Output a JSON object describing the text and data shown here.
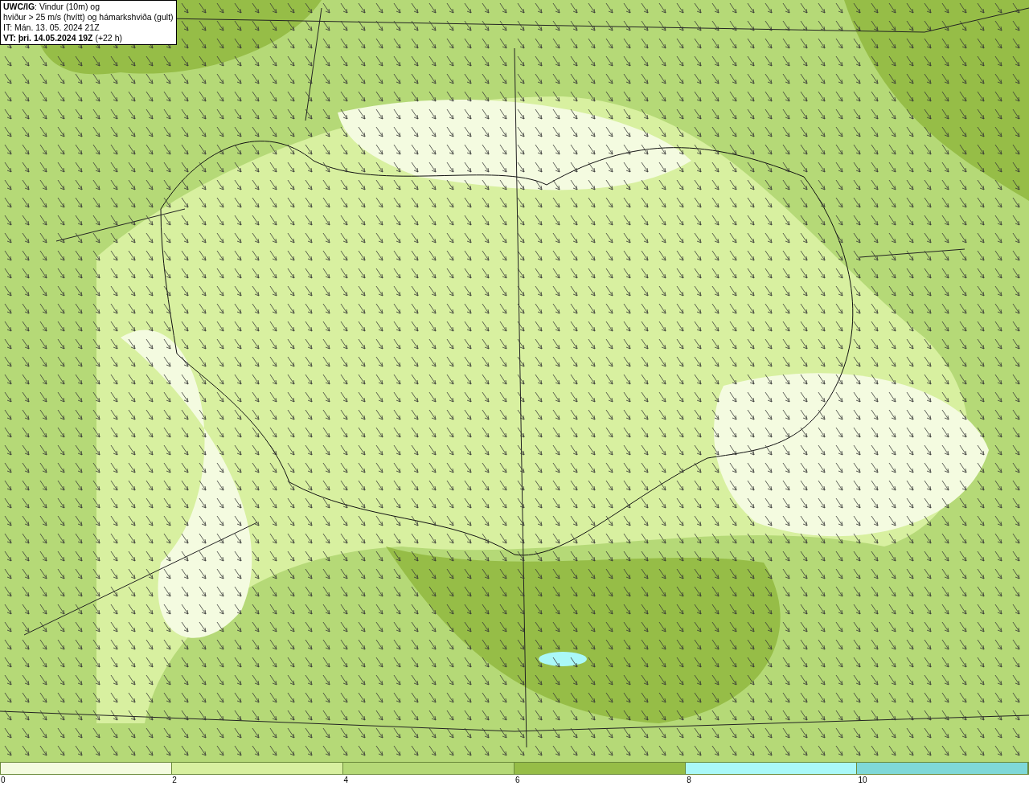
{
  "info_box": {
    "lines": [
      "**UWC/IG**: Vindur (10m) og",
      "hviður > 25 m/s (hvítt) og hámarkshviða (gult)",
      "IT: Mán. 13. 05. 2024 21Z",
      "**VT: þri. 14.05.2024 19Z** (+22 h)"
    ]
  },
  "colorbar": {
    "segments": [
      {
        "color": "#f4fbe0"
      },
      {
        "color": "#d8f0a0"
      },
      {
        "color": "#b5d977"
      },
      {
        "color": "#96bd47"
      },
      {
        "color": "#aaf8f8"
      },
      {
        "color": "#7fd8d8"
      }
    ],
    "ticks": [
      "0",
      "2",
      "4",
      "6",
      "8",
      "10"
    ]
  }
}
